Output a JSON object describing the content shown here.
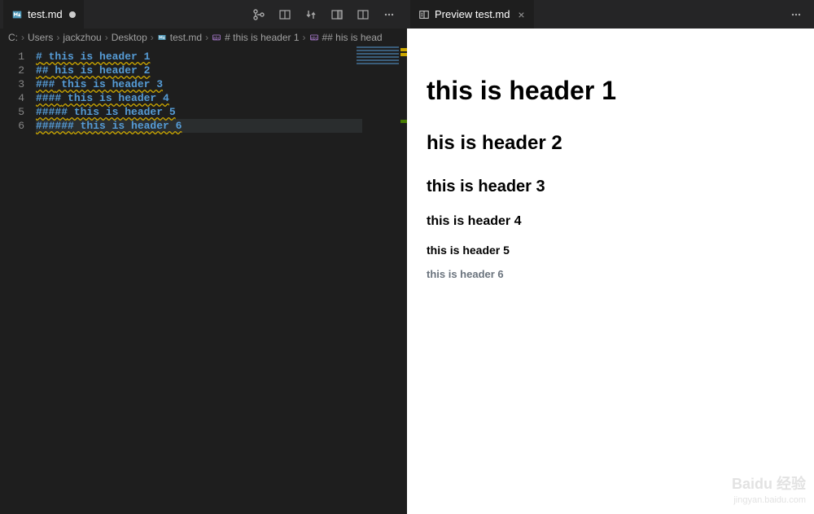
{
  "editor": {
    "tab": {
      "filename": "test.md",
      "dirty": true
    },
    "breadcrumb": {
      "items": [
        {
          "label": "C:"
        },
        {
          "label": "Users"
        },
        {
          "label": "jackzhou"
        },
        {
          "label": "Desktop"
        },
        {
          "label": "test.md",
          "icon": "markdown"
        },
        {
          "label": "# this is header 1",
          "icon": "symbol"
        },
        {
          "label": "## his is head",
          "icon": "symbol"
        }
      ]
    },
    "lines": [
      {
        "num": "1",
        "prefix": "#",
        "text": " this is header 1"
      },
      {
        "num": "2",
        "prefix": "##",
        "text": " his is header 2"
      },
      {
        "num": "3",
        "prefix": "###",
        "text": " this is header 3"
      },
      {
        "num": "4",
        "prefix": "####",
        "text": " this is header 4"
      },
      {
        "num": "5",
        "prefix": "#####",
        "text": " this is header 5"
      },
      {
        "num": "6",
        "prefix": "######",
        "text": " this is header 6"
      }
    ],
    "current_line": 6
  },
  "preview": {
    "tab": {
      "label": "Preview test.md"
    },
    "headers": {
      "h1": "this is header 1",
      "h2": "his is header 2",
      "h3": "this is header 3",
      "h4": "this is header 4",
      "h5": "this is header 5",
      "h6": "this is header 6"
    }
  },
  "watermark": {
    "line1": "Baidu 经验",
    "line2": "jingyan.baidu.com"
  }
}
